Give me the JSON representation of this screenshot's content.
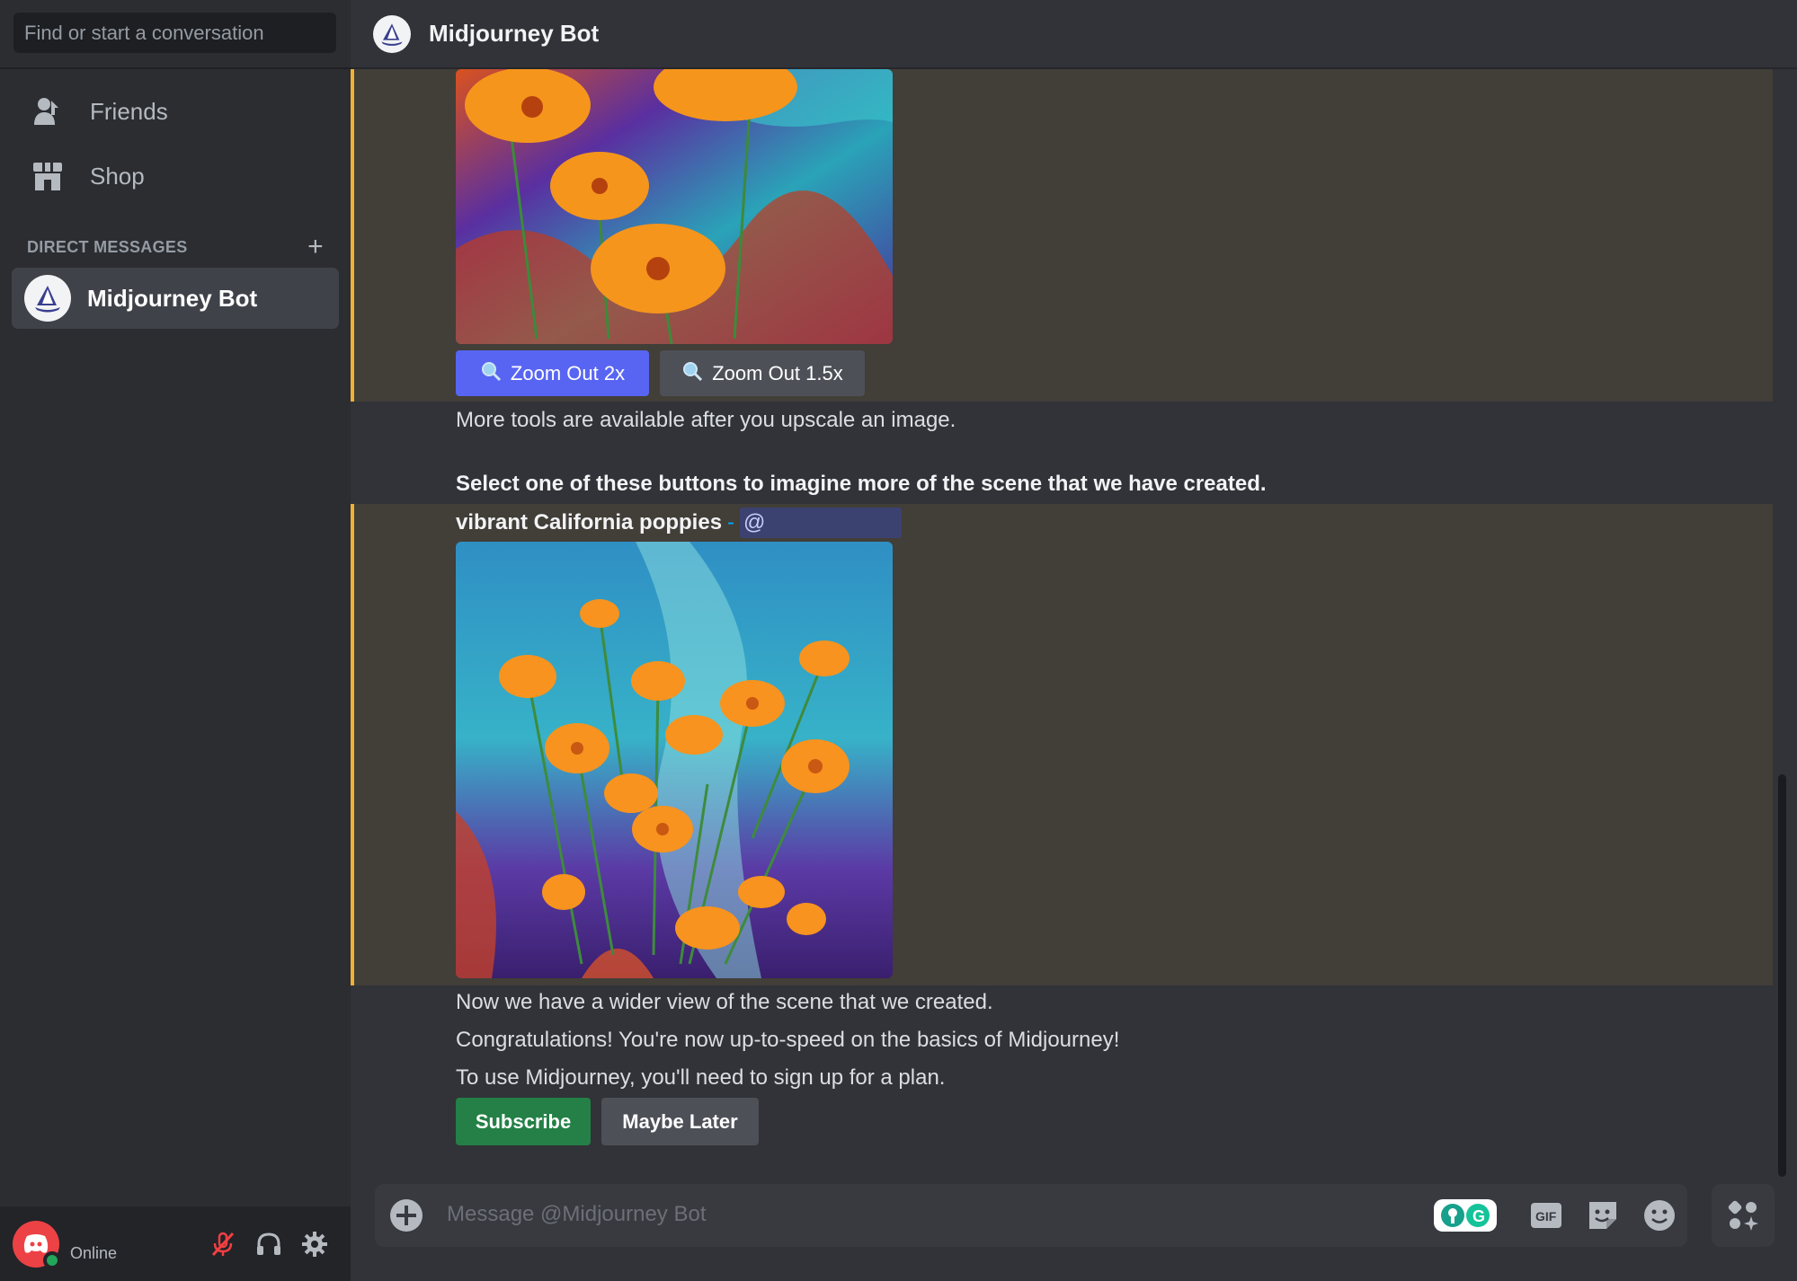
{
  "sidebar": {
    "search_placeholder": "Find or start a conversation",
    "nav": [
      {
        "label": "Friends",
        "icon": "friends-icon"
      },
      {
        "label": "Shop",
        "icon": "shop-icon"
      }
    ],
    "dm_header": "DIRECT MESSAGES",
    "dm_items": [
      {
        "name": "Midjourney Bot",
        "icon": "midjourney-avatar"
      }
    ],
    "user_panel": {
      "status": "Online",
      "status_color": "#23a55a",
      "icons": [
        "mic-muted-icon",
        "headphones-icon",
        "settings-gear-icon"
      ]
    }
  },
  "header": {
    "title": "Midjourney Bot"
  },
  "messages": {
    "zoom_buttons": [
      {
        "label": "Zoom Out 2x",
        "icon": "magnifier-icon"
      },
      {
        "label": "Zoom Out 1.5x",
        "icon": "magnifier-icon"
      }
    ],
    "more_tools": "More tools are available after you upscale an image.",
    "select_buttons": "Select one of these buttons to imagine more of the scene that we have created.",
    "prompt_text": "vibrant California poppies",
    "prompt_separator": "-",
    "mention": "@",
    "wider_view": "Now we have a wider view of the scene that we created.",
    "congrats": "Congratulations! You're now up-to-speed on the basics of Midjourney!",
    "sign_up": "To use Midjourney, you'll need to sign up for a plan.",
    "subscribe_label": "Subscribe",
    "maybe_later_label": "Maybe Later"
  },
  "composer": {
    "placeholder": "Message @Midjourney Bot",
    "icons": [
      "grammarly-icon",
      "gif-icon",
      "sticker-icon",
      "emoji-icon",
      "apps-icon"
    ],
    "gif_label": "GIF"
  },
  "colors": {
    "accent": "#5865f2",
    "success": "#248046",
    "highlight_border": "#f0b232",
    "highlight_bg": "#423e38"
  }
}
